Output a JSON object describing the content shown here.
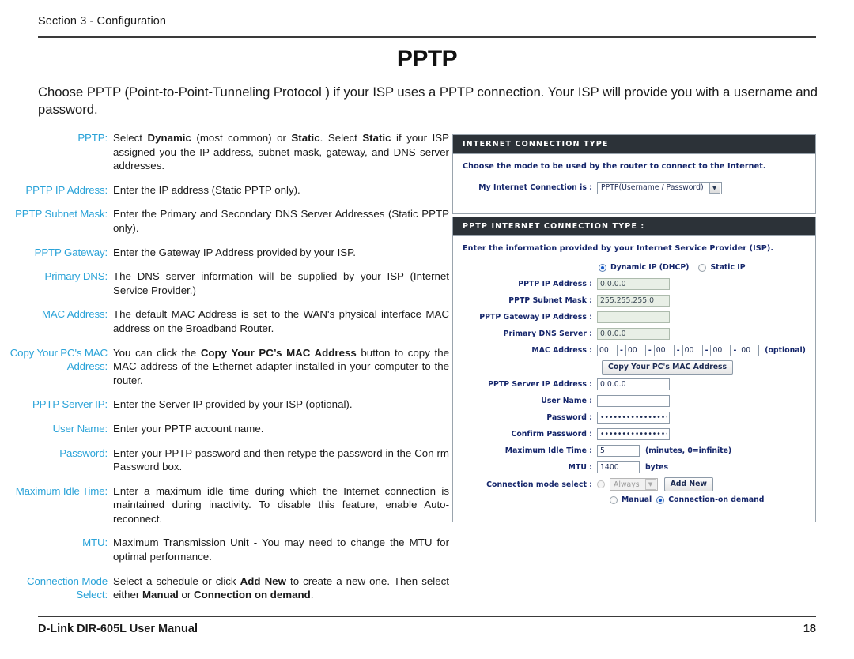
{
  "header": {
    "running_head": "Section 3 - Configuration"
  },
  "footer": {
    "manual_name": "D-Link DIR-605L User Manual",
    "page_number": "18"
  },
  "title": "PPTP",
  "intro": "Choose PPTP (Point-to-Point-Tunneling Protocol ) if your ISP uses a PPTP connection. Your ISP will provide you with a username and password.",
  "definitions": [
    {
      "term": "PPTP:",
      "desc_html": "Select <b>Dynamic</b> (most common) or <b>Static</b>. Select <b>Static</b> if your ISP assigned you the IP address, subnet mask, gateway, and DNS server addresses.",
      "desc_text": "Select Dynamic (most common) or Static. Select Static if your ISP assigned you the IP address, subnet mask, gateway, and DNS server addresses."
    },
    {
      "term": "PPTP IP Address:",
      "desc_html": "Enter the IP address (Static PPTP only).",
      "desc_text": "Enter the IP address (Static PPTP only)."
    },
    {
      "term": "PPTP Subnet Mask:",
      "desc_html": "Enter the Primary and Secondary DNS Server Addresses (Static PPTP only).",
      "desc_text": "Enter the Primary and Secondary DNS Server Addresses (Static PPTP only)."
    },
    {
      "term": "PPTP Gateway:",
      "desc_html": "Enter the Gateway IP Address provided by your ISP.",
      "desc_text": "Enter the Gateway IP Address provided by your ISP."
    },
    {
      "term": "Primary DNS:",
      "desc_html": "The DNS server information will be supplied by your ISP (Internet Service Provider.)",
      "desc_text": "The DNS server information will be supplied by your ISP (Internet Service Provider.)"
    },
    {
      "term": "MAC Address:",
      "desc_html": "The default MAC Address is set to the WAN's physical interface MAC address on the Broadband Router.",
      "desc_text": "The default MAC Address is set to the WAN's physical interface MAC address on the Broadband Router."
    },
    {
      "term": "Copy Your PC's MAC Address:",
      "desc_html": "You can click the <b>Copy Your PC’s MAC Address</b> button to copy the MAC address of the Ethernet adapter installed in your computer to the router.",
      "desc_text": "You can click the Copy Your PC’s MAC Address button to copy the MAC address of the Ethernet adapter installed in your computer to the router."
    },
    {
      "term": "PPTP Server IP:",
      "desc_html": "Enter the Server IP provided by your ISP (optional).",
      "desc_text": "Enter the Server IP provided by your ISP (optional)."
    },
    {
      "term": "User Name:",
      "desc_html": "Enter your PPTP account name.",
      "desc_text": "Enter your PPTP account name."
    },
    {
      "term": "Password:",
      "desc_html": "Enter your PPTP password and then retype the password in the Con rm Password box.",
      "desc_text": "Enter your PPTP password and then retype the password in the Con rm Password box."
    },
    {
      "term": "Maximum Idle Time:",
      "desc_html": "Enter a maximum idle time during which the Internet connection is maintained during inactivity. To disable this feature, enable Auto-reconnect.",
      "desc_text": "Enter a maximum idle time during which the Internet connection is maintained during inactivity. To disable this feature, enable Auto-reconnect."
    },
    {
      "term": "MTU:",
      "desc_html": "Maximum Transmission Unit - You may need to change the MTU for optimal performance.",
      "desc_text": "Maximum Transmission Unit - You may need to change the MTU for optimal performance."
    },
    {
      "term": "Connection Mode Select:",
      "desc_html": "Select a schedule or click <b>Add New</b> to create a new one. Then select either <b>Manual</b> or <b>Connection on demand</b>.",
      "desc_text": "Select a schedule or click Add New to create a new one. Then select either Manual or Connection on demand."
    }
  ],
  "router_ui": {
    "internet_connection_type": {
      "header": "INTERNET CONNECTION TYPE",
      "note": "Choose the mode to be used by the router to connect to the Internet.",
      "connection_label": "My Internet Connection is :",
      "connection_value": "PPTP(Username / Password)",
      "dropdown_arrow": "chevron-down-icon"
    },
    "pptp_connection_type": {
      "header": "PPTP INTERNET CONNECTION TYPE :",
      "note": "Enter the information provided by your Internet Service Provider (ISP).",
      "ip_mode": {
        "dynamic_label": "Dynamic IP (DHCP)",
        "static_label": "Static IP",
        "selected": "dynamic"
      },
      "fields": [
        {
          "label": "PPTP IP Address :",
          "value": "0.0.0.0",
          "disabled": true
        },
        {
          "label": "PPTP Subnet Mask :",
          "value": "255.255.255.0",
          "disabled": true
        },
        {
          "label": "PPTP Gateway IP Address :",
          "value": "",
          "disabled": true
        },
        {
          "label": "Primary DNS Server :",
          "value": "0.0.0.0",
          "disabled": true
        }
      ],
      "mac_address": {
        "label": "MAC Address :",
        "octets": [
          "00",
          "00",
          "00",
          "00",
          "00",
          "00"
        ],
        "separator": "-",
        "suffix": "(optional)"
      },
      "copy_mac_button": "Copy Your PC's MAC Address",
      "server_ip": {
        "label": "PPTP Server IP Address :",
        "value": "0.0.0.0"
      },
      "user_name": {
        "label": "User Name :",
        "value": ""
      },
      "password": {
        "label": "Password :",
        "value": "••••••••••••••••••••••••••••"
      },
      "confirm_password": {
        "label": "Confirm Password :",
        "value": "••••••••••••••••••••••••••••"
      },
      "max_idle_time": {
        "label": "Maximum Idle Time :",
        "value": "5",
        "suffix": "(minutes, 0=infinite)"
      },
      "mtu": {
        "label": "MTU :",
        "value": "1400",
        "suffix": "bytes"
      },
      "connection_mode": {
        "label": "Connection mode select :",
        "schedule_value": "Always",
        "add_new_button": "Add New",
        "manual_label": "Manual",
        "on_demand_label": "Connection-on demand",
        "selected": "on_demand"
      }
    }
  },
  "colors": {
    "term_blue": "#2ba3d8",
    "panel_header_bg": "#2c3238",
    "note_blue": "#15266b",
    "disabled_field_bg": "#e8efe6"
  }
}
